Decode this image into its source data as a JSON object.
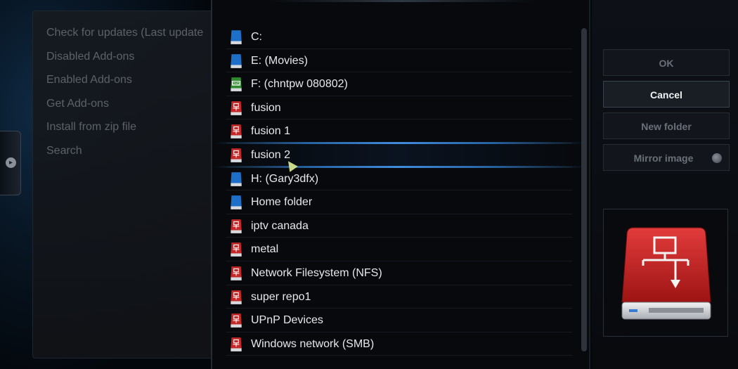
{
  "left_menu": {
    "items": [
      {
        "label": "Check for updates (Last update"
      },
      {
        "label": "Disabled Add-ons"
      },
      {
        "label": "Enabled Add-ons"
      },
      {
        "label": "Get Add-ons"
      },
      {
        "label": "Install from zip file"
      },
      {
        "label": "Search"
      }
    ]
  },
  "file_list": {
    "items": [
      {
        "label": "C:",
        "icon": "blue-drive-icon"
      },
      {
        "label": "E: (Movies)",
        "icon": "blue-drive-icon"
      },
      {
        "label": "F: (chntpw 080802)",
        "icon": "green-dvd-drive-icon"
      },
      {
        "label": "fusion",
        "icon": "red-network-drive-icon"
      },
      {
        "label": "fusion 1",
        "icon": "red-network-drive-icon"
      },
      {
        "label": "fusion 2",
        "icon": "red-network-drive-icon",
        "selected": true
      },
      {
        "label": "H: (Gary3dfx)",
        "icon": "blue-drive-icon"
      },
      {
        "label": "Home folder",
        "icon": "blue-drive-icon"
      },
      {
        "label": "iptv canada",
        "icon": "red-network-drive-icon"
      },
      {
        "label": "metal",
        "icon": "red-network-drive-icon"
      },
      {
        "label": "Network Filesystem (NFS)",
        "icon": "red-network-drive-icon"
      },
      {
        "label": "super repo1",
        "icon": "red-network-drive-icon"
      },
      {
        "label": "UPnP Devices",
        "icon": "red-network-drive-icon"
      },
      {
        "label": "Windows network (SMB)",
        "icon": "red-network-drive-icon"
      }
    ]
  },
  "buttons": {
    "ok": "OK",
    "cancel": "Cancel",
    "new_folder": "New folder",
    "mirror_image": "Mirror image"
  },
  "colors": {
    "drive_blue": "#1e6fc8",
    "drive_red": "#c62828",
    "drive_green": "#2e8b2e",
    "selection_glow": "#4aa0ff"
  }
}
